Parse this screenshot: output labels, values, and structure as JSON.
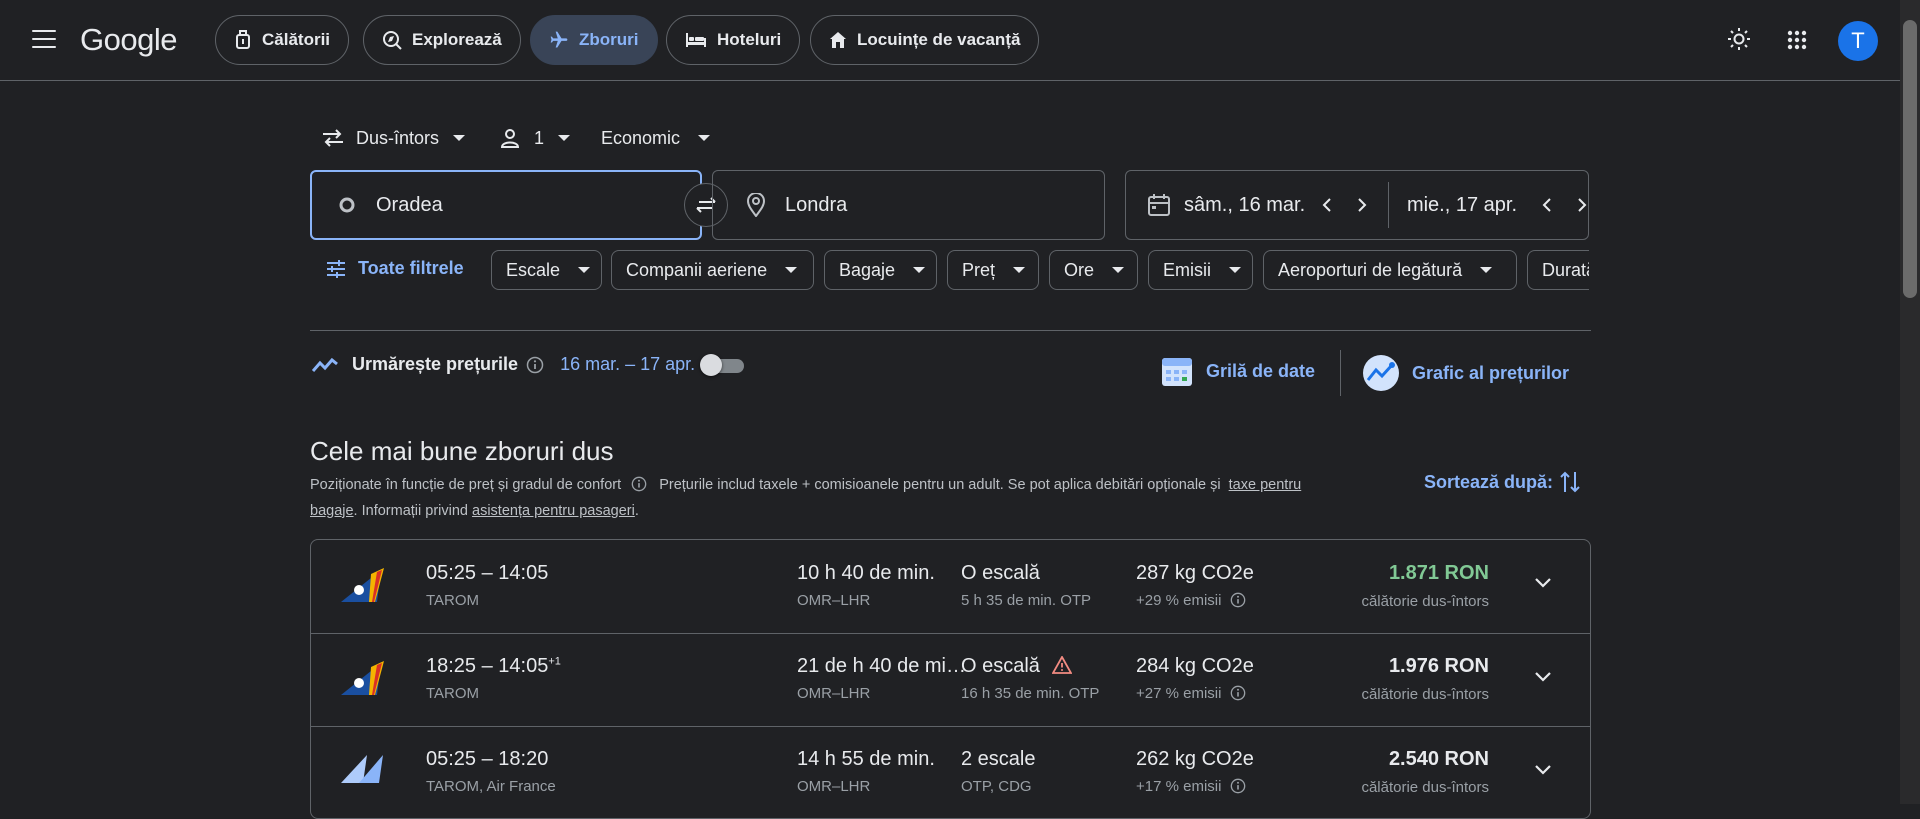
{
  "header": {
    "logo": "Google",
    "tabs": [
      {
        "label": "Călătorii",
        "icon": "suitcase-icon"
      },
      {
        "label": "Explorează",
        "icon": "explore-icon"
      },
      {
        "label": "Zboruri",
        "icon": "airplane-icon",
        "active": true
      },
      {
        "label": "Hoteluri",
        "icon": "bed-icon"
      },
      {
        "label": "Locuințe de vacanță",
        "icon": "house-icon"
      }
    ],
    "avatar_letter": "T"
  },
  "search": {
    "trip_type": "Dus-întors",
    "passengers": "1",
    "cabin_class": "Economic",
    "origin": "Oradea",
    "destination": "Londra",
    "depart_date": "sâm., 16 mar.",
    "return_date": "mie., 17 apr."
  },
  "filters": {
    "all_filters_label": "Toate filtrele",
    "chips": [
      "Escale",
      "Companii aeriene",
      "Bagaje",
      "Preț",
      "Ore",
      "Emisii",
      "Aeroporturi de legătură",
      "Durată"
    ]
  },
  "tracking": {
    "label": "Urmărește prețurile",
    "date_range": "16 mar. – 17 apr.",
    "enabled": false,
    "date_grid_label": "Grilă de date",
    "price_graph_label": "Grafic al prețurilor"
  },
  "section": {
    "title": "Cele mai bune zboruri dus",
    "ranking_note": "Poziționate în funcție de preț și gradul de confort",
    "prices_note": "Prețurile includ taxele + comisioanele pentru un adult. Se pot aplica debitări opționale și",
    "baggage_fees_link_1": "taxe pentru",
    "baggage_fees_link_2": "bagaje",
    "info_text": ". Informații privind",
    "assistance_link": "asistența pentru pasageri",
    "end_period": ".",
    "sort_label": "Sortează după:"
  },
  "flights": [
    {
      "times": "05:25 – 14:05",
      "day_offset": "",
      "airline": "TAROM",
      "duration": "10 h 40 de min.",
      "route": "OMR–LHR",
      "stops": "O escală",
      "stop_detail": "5 h 35 de min. OTP",
      "warning": false,
      "emissions": "287 kg CO2e",
      "emissions_delta": "+29 % emisii",
      "price": "1.871 RON",
      "price_color": "#81c995",
      "price_note": "călătorie dus-întors",
      "logo": "tarom-logo"
    },
    {
      "times": "18:25 – 14:05",
      "day_offset": "+1",
      "airline": "TAROM",
      "duration": "21 de h 40 de mi…",
      "route": "OMR–LHR",
      "stops": "O escală",
      "stop_detail": "16 h 35 de min. OTP",
      "warning": true,
      "emissions": "284 kg CO2e",
      "emissions_delta": "+27 % emisii",
      "price": "1.976 RON",
      "price_color": "#e8eaed",
      "price_note": "călătorie dus-întors",
      "logo": "tarom-logo"
    },
    {
      "times": "05:25 – 18:20",
      "day_offset": "",
      "airline": "TAROM, Air France",
      "duration": "14 h 55 de min.",
      "route": "OMR–LHR",
      "stops": "2 escale",
      "stop_detail": "OTP, CDG",
      "warning": false,
      "emissions": "262 kg CO2e",
      "emissions_delta": "+17 % emisii",
      "price": "2.540 RON",
      "price_color": "#e8eaed",
      "price_note": "călătorie dus-întors",
      "logo": "multi-airline-logo"
    }
  ]
}
